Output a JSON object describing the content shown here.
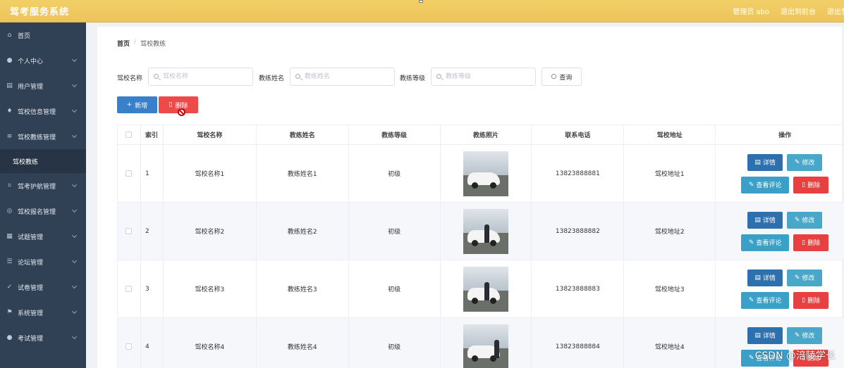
{
  "header": {
    "title": "驾考服务系统",
    "user": "管理员 abo",
    "back": "退出到前台",
    "logout": "退出登"
  },
  "sidebar": {
    "items": [
      {
        "label": "首页",
        "icon": "home-icon"
      },
      {
        "label": "个人中心",
        "icon": "user-icon"
      },
      {
        "label": "用户管理",
        "icon": "folder-icon"
      },
      {
        "label": "驾校信息管理",
        "icon": "mic-icon"
      },
      {
        "label": "驾校教练管理",
        "icon": "menu-icon"
      },
      {
        "label": "驾校教练",
        "icon": ""
      },
      {
        "label": "驾考护航管理",
        "icon": "crop-icon"
      },
      {
        "label": "驾校报名管理",
        "icon": "globe-icon"
      },
      {
        "label": "试题管理",
        "icon": "list-icon"
      },
      {
        "label": "论坛管理",
        "icon": "sliders-icon"
      },
      {
        "label": "试卷管理",
        "icon": "check-icon"
      },
      {
        "label": "系统管理",
        "icon": "flag-icon"
      },
      {
        "label": "考试管理",
        "icon": "user-icon"
      }
    ]
  },
  "breadcrumb": {
    "home": "首页",
    "sep": "/",
    "current": "驾校教练"
  },
  "filters": {
    "school_label": "驾校名称",
    "school_placeholder": "驾校名称",
    "coach_label": "教练姓名",
    "coach_placeholder": "教练姓名",
    "level_label": "教练等级",
    "level_placeholder": "教练等级",
    "query": "查询"
  },
  "actions": {
    "add": "新增",
    "delete": "删除"
  },
  "table": {
    "headers": [
      "索引",
      "驾校名称",
      "教练姓名",
      "教练等级",
      "教练照片",
      "联系电话",
      "驾校地址",
      "操作"
    ],
    "rows": [
      {
        "index": "1",
        "school": "驾校名称1",
        "coach": "教练姓名1",
        "level": "初级",
        "phone": "13823888881",
        "address": "驾校地址1"
      },
      {
        "index": "2",
        "school": "驾校名称2",
        "coach": "教练姓名2",
        "level": "初级",
        "phone": "13823888882",
        "address": "驾校地址2"
      },
      {
        "index": "3",
        "school": "驾校名称3",
        "coach": "教练姓名3",
        "level": "初级",
        "phone": "13823888883",
        "address": "驾校地址3"
      },
      {
        "index": "4",
        "school": "驾校名称4",
        "coach": "教练姓名4",
        "level": "初级",
        "phone": "13823888884",
        "address": "驾校地址4"
      }
    ],
    "ops": {
      "detail": "详情",
      "edit": "修改",
      "comment": "查看评论",
      "delete": "删除"
    }
  },
  "watermark": "CSDN @涪陵学长"
}
